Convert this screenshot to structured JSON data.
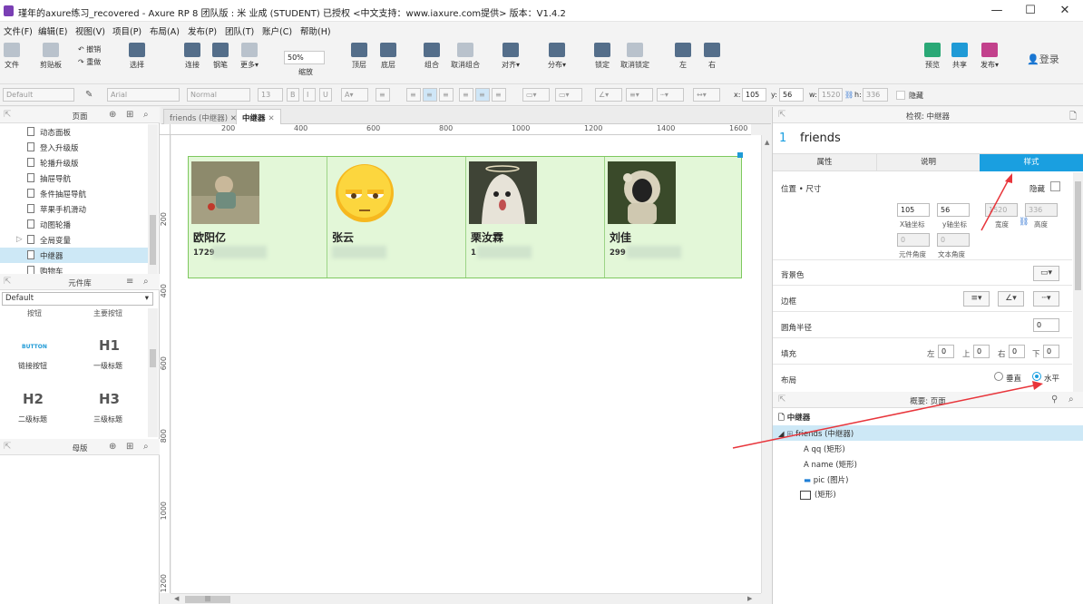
{
  "window": {
    "title": "瑾年的axure练习_recovered - Axure RP 8 团队版 : 米 业成 (STUDENT) 已授权      <中文支持：www.iaxure.com提供> 版本：V1.4.2",
    "minimize": "—",
    "maximize": "☐",
    "close": "✕"
  },
  "menu": [
    "文件(F)",
    "编辑(E)",
    "视图(V)",
    "项目(P)",
    "布局(A)",
    "发布(P)",
    "团队(T)",
    "账户(C)",
    "帮助(H)"
  ],
  "toolbar": {
    "file": "文件",
    "clipboard": "剪贴板",
    "undo": "撤销",
    "redo": "重做",
    "select": "选择",
    "connect": "连接",
    "pen": "钢笔",
    "more": "更多▾",
    "zoom": "50%",
    "zoom_label": "缩放",
    "top": "顶层",
    "bottom": "底层",
    "group": "组合",
    "ungroup": "取消组合",
    "align": "对齐▾",
    "distribute": "分布▾",
    "lock": "锁定",
    "unlock": "取消锁定",
    "left": "左",
    "right": "右",
    "preview": "预览",
    "share": "共享",
    "publish": "发布▾",
    "login": "登录"
  },
  "format": {
    "style": "Default",
    "font": "Arial",
    "weight": "Normal",
    "size": "13",
    "x_label": "x:",
    "x": "105",
    "y_label": "y:",
    "y": "56",
    "w_label": "w:",
    "w": "1520",
    "h_label": "h:",
    "h": "336",
    "hidden": "隐藏"
  },
  "pages_panel": {
    "title": "页面",
    "items": [
      {
        "label": "动态面板"
      },
      {
        "label": "登入升级版"
      },
      {
        "label": "轮播升级版"
      },
      {
        "label": "抽屉导航"
      },
      {
        "label": "条件抽屉导航"
      },
      {
        "label": "苹果手机滑动"
      },
      {
        "label": "动图轮播"
      },
      {
        "label": "全局变量"
      },
      {
        "label": "中继器"
      },
      {
        "label": "购物车"
      }
    ],
    "selected_index": 8
  },
  "library_panel": {
    "title": "元件库",
    "library": "Default",
    "partial": [
      "按钮",
      "主要按钮"
    ],
    "items": [
      {
        "preview": "BUTTON",
        "label": "链接按钮"
      },
      {
        "preview": "H1",
        "label": "一级标题"
      },
      {
        "preview": "H2",
        "label": "二级标题"
      },
      {
        "preview": "H3",
        "label": "三级标题"
      }
    ]
  },
  "masters_panel": {
    "title": "母版"
  },
  "tabs": [
    {
      "label": "friends (中继器)",
      "close": "✕"
    },
    {
      "label": "中继器",
      "close": "✕"
    }
  ],
  "ruler_h": [
    "200",
    "400",
    "600",
    "800",
    "1000",
    "1200",
    "1400",
    "1600"
  ],
  "ruler_v": [
    "200",
    "400",
    "600",
    "800",
    "1000",
    "1200"
  ],
  "cards": [
    {
      "name": "欧阳亿",
      "qq": "1729"
    },
    {
      "name": "张云",
      "qq": ""
    },
    {
      "name": "栗汝霖",
      "qq": "1"
    },
    {
      "name": "刘佳",
      "qq": "299"
    }
  ],
  "inspector": {
    "header": "检视: 中继器",
    "index": "1",
    "name": "friends",
    "tabs": [
      "属性",
      "说明",
      "样式"
    ],
    "active_tab": "样式",
    "pos_size": "位置 • 尺寸",
    "hidden": "隐藏",
    "x": "105",
    "y": "56",
    "w": "1520",
    "h": "336",
    "x_label": "X轴坐标",
    "y_label": "y轴坐标",
    "w_label": "宽度",
    "h_label": "高度",
    "rot1": "0",
    "rot2": "0",
    "rot1_label": "元件角度",
    "rot2_label": "文本角度",
    "fill": "背景色",
    "border": "边框",
    "radius": "圆角半径",
    "radius_val": "0",
    "padding": "填充",
    "pad": [
      {
        "label": "左",
        "val": "0"
      },
      {
        "label": "上",
        "val": "0"
      },
      {
        "label": "右",
        "val": "0"
      },
      {
        "label": "下",
        "val": "0"
      }
    ],
    "layout": "布局",
    "vertical": "垂直",
    "horizontal": "水平"
  },
  "outline": {
    "header": "概要: 页面",
    "page": "中继器",
    "items": [
      {
        "label": "friends (中继器)",
        "icon": "repeater-icon"
      },
      {
        "label": "qq (矩形)",
        "icon": "text-icon"
      },
      {
        "label": "name (矩形)",
        "icon": "text-icon"
      },
      {
        "label": "pic (图片)",
        "icon": "image-icon"
      },
      {
        "label": "(矩形)",
        "icon": "rectangle-icon"
      }
    ]
  },
  "colors": {
    "accent": "#1a9fe0",
    "repeater_fill": "#e3f7d8",
    "repeater_border": "#7ec85f",
    "arrow": "#e8353b"
  }
}
